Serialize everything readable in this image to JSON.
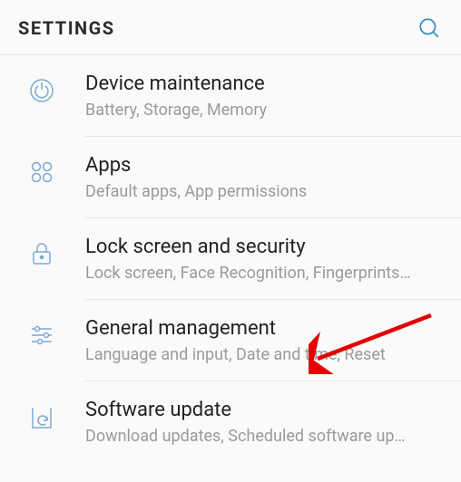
{
  "header": {
    "title": "SETTINGS"
  },
  "items": [
    {
      "icon": "maintenance-icon",
      "title": "Device maintenance",
      "subtitle": "Battery, Storage, Memory"
    },
    {
      "icon": "apps-icon",
      "title": "Apps",
      "subtitle": "Default apps, App permissions"
    },
    {
      "icon": "lock-icon",
      "title": "Lock screen and security",
      "subtitle": "Lock screen, Face Recognition, Fingerprints…"
    },
    {
      "icon": "sliders-icon",
      "title": "General management",
      "subtitle": "Language and input, Date and time, Reset"
    },
    {
      "icon": "update-icon",
      "title": "Software update",
      "subtitle": "Download updates, Scheduled software up…"
    }
  ],
  "annotation": {
    "type": "arrow",
    "color": "#e40000",
    "points_to": "General management"
  }
}
